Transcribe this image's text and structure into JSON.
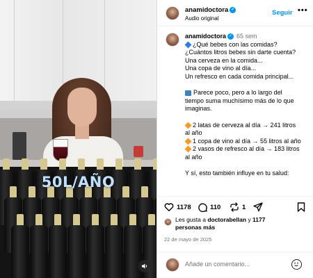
{
  "video": {
    "overlay_text": "50L/AÑO"
  },
  "header": {
    "username": "anamidoctora",
    "subtitle": "Audio original",
    "follow_label": "Seguir",
    "more_label": "•••"
  },
  "caption": {
    "username": "anamidoctora",
    "time": "65 sem",
    "lines": [
      "¿Qué bebes con las comidas?",
      "¿Cuántos litros bebes sin darte cuenta?",
      "Una cerveza en la comida...",
      "Una copa de vino al día...",
      "Un refresco en cada comida principal...",
      "",
      "Parece poco, pero a lo largo del",
      "tiempo suma muchísimo más de lo que",
      "imaginas.",
      "",
      "2 latas de cerveza al día → 241 litros",
      "al año",
      "1 copa de vino al día → 55 litros al año",
      "2 vasos de refresco al día → 183 litros",
      "al año",
      "",
      "Y sí, esto también influye en tu salud:"
    ]
  },
  "actions": {
    "likes_count": "1178",
    "comments_count": "110",
    "shares_count": "1"
  },
  "likes": {
    "prefix": "Les gusta a ",
    "user": "doctorabellan",
    "middle": " y ",
    "others": "1177",
    "suffix": "personas más"
  },
  "date": "22 de mayo de 2025",
  "comment": {
    "placeholder": "Añade un comentario..."
  },
  "colors": {
    "accent": "#0095f6",
    "muted": "#737373"
  }
}
